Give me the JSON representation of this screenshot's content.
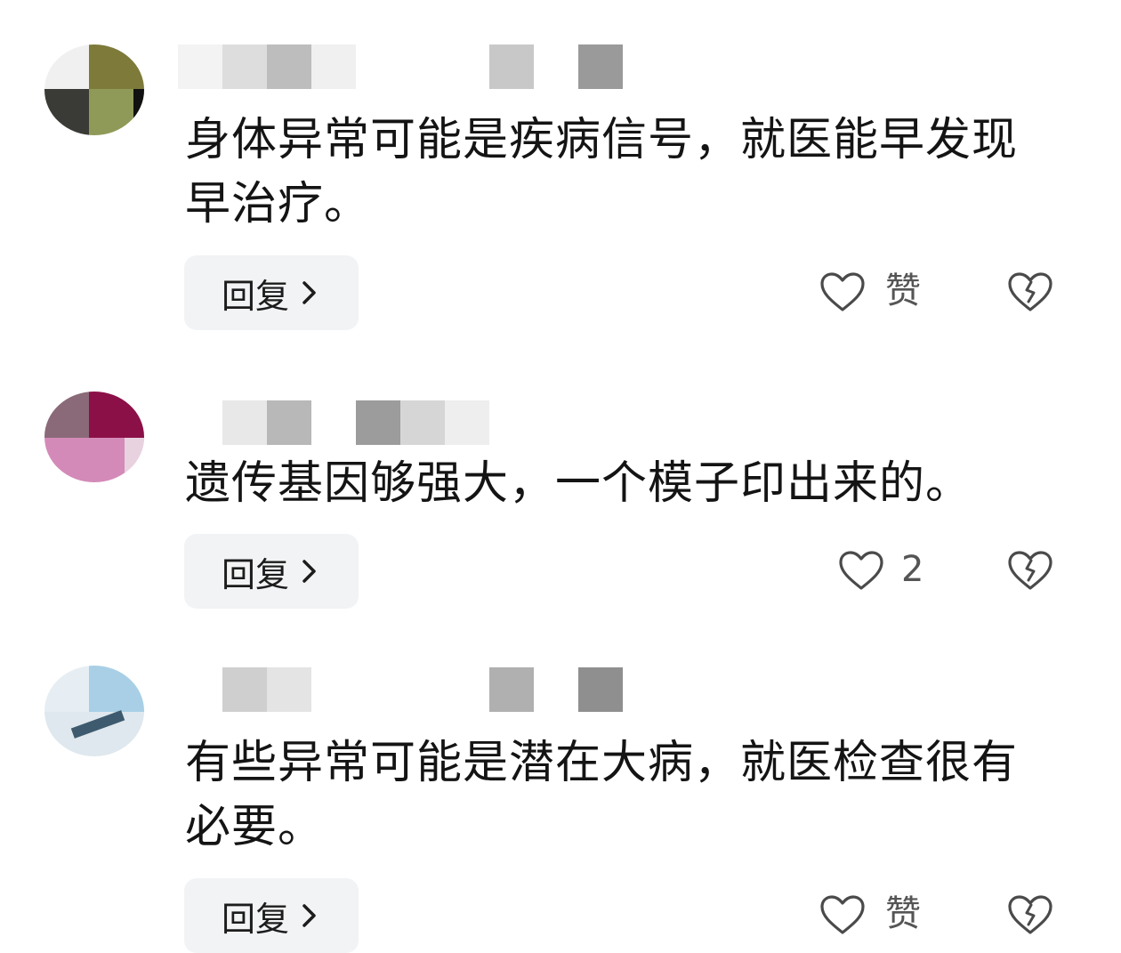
{
  "colors": {
    "text": "#141414",
    "muted": "#555555",
    "reply_bg": "#f2f3f5",
    "icon_stroke": "#4a4a4a"
  },
  "icons": {
    "reply": "chevron-right-icon",
    "like": "heart-outline-icon",
    "dislike": "broken-heart-icon"
  },
  "comments": [
    {
      "text": "身体异常可能是疾病信号，就医能早发现早治疗。",
      "reply_label": "回复",
      "like_label": "赞"
    },
    {
      "text": "遗传基因够强大，一个模子印出来的。",
      "reply_label": "回复",
      "like_label": "2"
    },
    {
      "text": "有些异常可能是潜在大病，就医检查很有必要。",
      "reply_label": "回复",
      "like_label": "赞"
    }
  ]
}
